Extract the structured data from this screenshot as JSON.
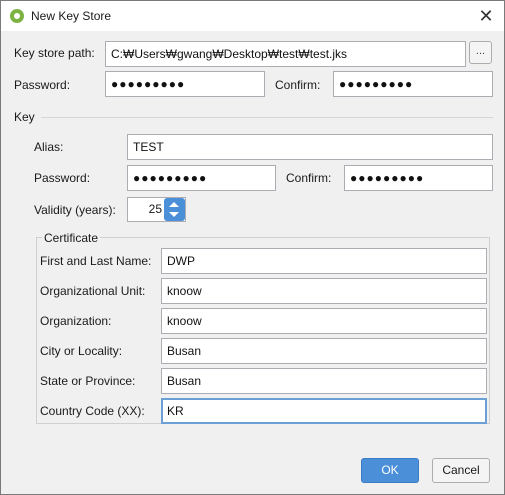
{
  "window": {
    "title": "New Key Store"
  },
  "keystore": {
    "path_label": "Key store path:",
    "path_value": "C:₩Users₩gwang₩Desktop₩test₩test.jks",
    "browse_label": "...",
    "password_label": "Password:",
    "password_value": "●●●●●●●●●",
    "confirm_label": "Confirm:",
    "confirm_value": "●●●●●●●●●"
  },
  "key": {
    "section_label": "Key",
    "alias_label": "Alias:",
    "alias_value": "TEST",
    "password_label": "Password:",
    "password_value": "●●●●●●●●●",
    "confirm_label": "Confirm:",
    "confirm_value": "●●●●●●●●●",
    "validity_label": "Validity (years):",
    "validity_value": "25"
  },
  "certificate": {
    "title": "Certificate",
    "fields": [
      {
        "label": "First and Last Name:",
        "value": "DWP"
      },
      {
        "label": "Organizational Unit:",
        "value": "knoow"
      },
      {
        "label": "Organization:",
        "value": "knoow"
      },
      {
        "label": "City or Locality:",
        "value": "Busan"
      },
      {
        "label": "State or Province:",
        "value": "Busan"
      },
      {
        "label": "Country Code (XX):",
        "value": "KR"
      }
    ]
  },
  "buttons": {
    "ok": "OK",
    "cancel": "Cancel"
  },
  "colors": {
    "accent": "#4a8fd8",
    "focus_border": "#6ba0d6",
    "app_icon": "#7cb342"
  }
}
